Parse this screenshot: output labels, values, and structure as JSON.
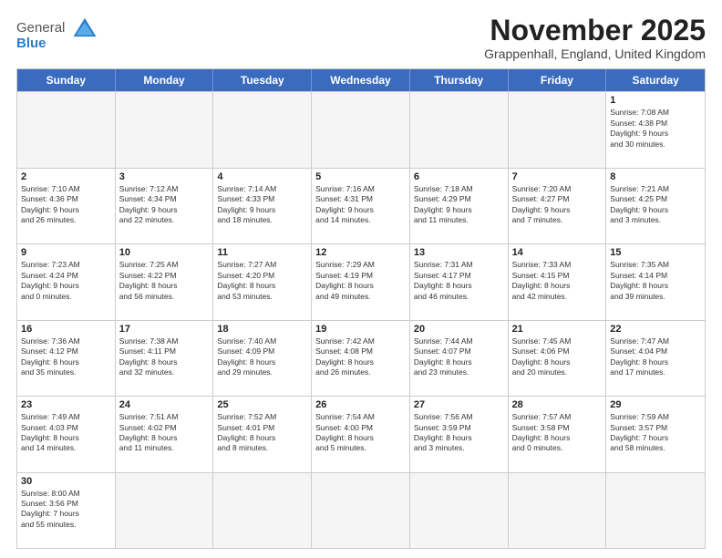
{
  "header": {
    "logo_general": "General",
    "logo_blue": "Blue",
    "month_title": "November 2025",
    "location": "Grappenhall, England, United Kingdom"
  },
  "days_of_week": [
    "Sunday",
    "Monday",
    "Tuesday",
    "Wednesday",
    "Thursday",
    "Friday",
    "Saturday"
  ],
  "weeks": [
    [
      {
        "day": "",
        "info": "",
        "empty": true
      },
      {
        "day": "",
        "info": "",
        "empty": true
      },
      {
        "day": "",
        "info": "",
        "empty": true
      },
      {
        "day": "",
        "info": "",
        "empty": true
      },
      {
        "day": "",
        "info": "",
        "empty": true
      },
      {
        "day": "",
        "info": "",
        "empty": true
      },
      {
        "day": "1",
        "info": "Sunrise: 7:08 AM\nSunset: 4:38 PM\nDaylight: 9 hours\nand 30 minutes."
      }
    ],
    [
      {
        "day": "2",
        "info": "Sunrise: 7:10 AM\nSunset: 4:36 PM\nDaylight: 9 hours\nand 26 minutes."
      },
      {
        "day": "3",
        "info": "Sunrise: 7:12 AM\nSunset: 4:34 PM\nDaylight: 9 hours\nand 22 minutes."
      },
      {
        "day": "4",
        "info": "Sunrise: 7:14 AM\nSunset: 4:33 PM\nDaylight: 9 hours\nand 18 minutes."
      },
      {
        "day": "5",
        "info": "Sunrise: 7:16 AM\nSunset: 4:31 PM\nDaylight: 9 hours\nand 14 minutes."
      },
      {
        "day": "6",
        "info": "Sunrise: 7:18 AM\nSunset: 4:29 PM\nDaylight: 9 hours\nand 11 minutes."
      },
      {
        "day": "7",
        "info": "Sunrise: 7:20 AM\nSunset: 4:27 PM\nDaylight: 9 hours\nand 7 minutes."
      },
      {
        "day": "8",
        "info": "Sunrise: 7:21 AM\nSunset: 4:25 PM\nDaylight: 9 hours\nand 3 minutes."
      }
    ],
    [
      {
        "day": "9",
        "info": "Sunrise: 7:23 AM\nSunset: 4:24 PM\nDaylight: 9 hours\nand 0 minutes."
      },
      {
        "day": "10",
        "info": "Sunrise: 7:25 AM\nSunset: 4:22 PM\nDaylight: 8 hours\nand 56 minutes."
      },
      {
        "day": "11",
        "info": "Sunrise: 7:27 AM\nSunset: 4:20 PM\nDaylight: 8 hours\nand 53 minutes."
      },
      {
        "day": "12",
        "info": "Sunrise: 7:29 AM\nSunset: 4:19 PM\nDaylight: 8 hours\nand 49 minutes."
      },
      {
        "day": "13",
        "info": "Sunrise: 7:31 AM\nSunset: 4:17 PM\nDaylight: 8 hours\nand 46 minutes."
      },
      {
        "day": "14",
        "info": "Sunrise: 7:33 AM\nSunset: 4:15 PM\nDaylight: 8 hours\nand 42 minutes."
      },
      {
        "day": "15",
        "info": "Sunrise: 7:35 AM\nSunset: 4:14 PM\nDaylight: 8 hours\nand 39 minutes."
      }
    ],
    [
      {
        "day": "16",
        "info": "Sunrise: 7:36 AM\nSunset: 4:12 PM\nDaylight: 8 hours\nand 35 minutes."
      },
      {
        "day": "17",
        "info": "Sunrise: 7:38 AM\nSunset: 4:11 PM\nDaylight: 8 hours\nand 32 minutes."
      },
      {
        "day": "18",
        "info": "Sunrise: 7:40 AM\nSunset: 4:09 PM\nDaylight: 8 hours\nand 29 minutes."
      },
      {
        "day": "19",
        "info": "Sunrise: 7:42 AM\nSunset: 4:08 PM\nDaylight: 8 hours\nand 26 minutes."
      },
      {
        "day": "20",
        "info": "Sunrise: 7:44 AM\nSunset: 4:07 PM\nDaylight: 8 hours\nand 23 minutes."
      },
      {
        "day": "21",
        "info": "Sunrise: 7:45 AM\nSunset: 4:06 PM\nDaylight: 8 hours\nand 20 minutes."
      },
      {
        "day": "22",
        "info": "Sunrise: 7:47 AM\nSunset: 4:04 PM\nDaylight: 8 hours\nand 17 minutes."
      }
    ],
    [
      {
        "day": "23",
        "info": "Sunrise: 7:49 AM\nSunset: 4:03 PM\nDaylight: 8 hours\nand 14 minutes."
      },
      {
        "day": "24",
        "info": "Sunrise: 7:51 AM\nSunset: 4:02 PM\nDaylight: 8 hours\nand 11 minutes."
      },
      {
        "day": "25",
        "info": "Sunrise: 7:52 AM\nSunset: 4:01 PM\nDaylight: 8 hours\nand 8 minutes."
      },
      {
        "day": "26",
        "info": "Sunrise: 7:54 AM\nSunset: 4:00 PM\nDaylight: 8 hours\nand 5 minutes."
      },
      {
        "day": "27",
        "info": "Sunrise: 7:56 AM\nSunset: 3:59 PM\nDaylight: 8 hours\nand 3 minutes."
      },
      {
        "day": "28",
        "info": "Sunrise: 7:57 AM\nSunset: 3:58 PM\nDaylight: 8 hours\nand 0 minutes."
      },
      {
        "day": "29",
        "info": "Sunrise: 7:59 AM\nSunset: 3:57 PM\nDaylight: 7 hours\nand 58 minutes."
      }
    ],
    [
      {
        "day": "30",
        "info": "Sunrise: 8:00 AM\nSunset: 3:56 PM\nDaylight: 7 hours\nand 55 minutes."
      },
      {
        "day": "",
        "info": "",
        "empty": true
      },
      {
        "day": "",
        "info": "",
        "empty": true
      },
      {
        "day": "",
        "info": "",
        "empty": true
      },
      {
        "day": "",
        "info": "",
        "empty": true
      },
      {
        "day": "",
        "info": "",
        "empty": true
      },
      {
        "day": "",
        "info": "",
        "empty": true
      }
    ]
  ]
}
